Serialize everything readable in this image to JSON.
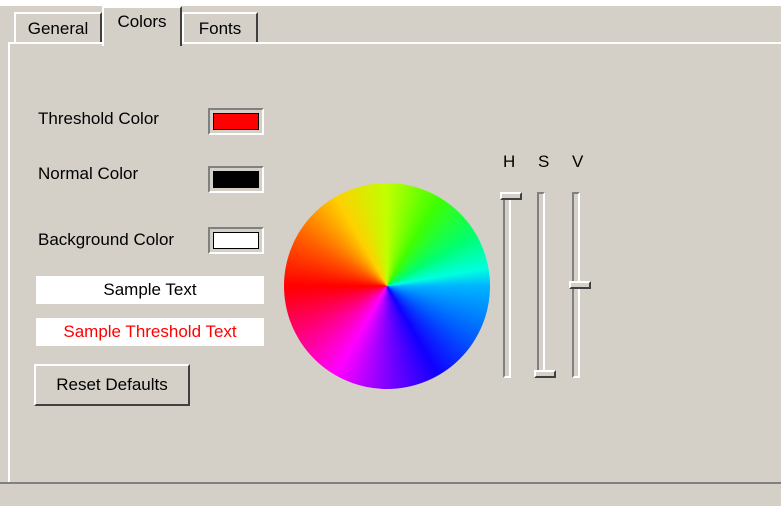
{
  "tabs": [
    {
      "label": "General",
      "active": false
    },
    {
      "label": "Colors",
      "active": true
    },
    {
      "label": "Fonts",
      "active": false
    }
  ],
  "colors": {
    "threshold": {
      "label": "Threshold Color",
      "value": "#ff0000"
    },
    "normal": {
      "label": "Normal Color",
      "value": "#000000"
    },
    "background": {
      "label": "Background Color",
      "value": "#ffffff"
    }
  },
  "samples": {
    "normal_text": "Sample Text",
    "threshold_text": "Sample Threshold Text"
  },
  "reset_label": "Reset Defaults",
  "hsv": {
    "labels": [
      "H",
      "S",
      "V"
    ],
    "h_level": 1.0,
    "s_level": 0.0,
    "v_level": 0.5
  }
}
